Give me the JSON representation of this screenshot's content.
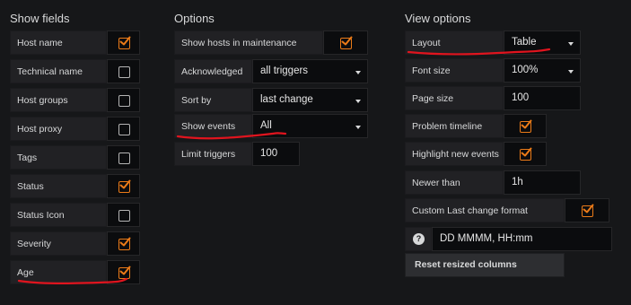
{
  "sections": {
    "show_fields": "Show fields",
    "options": "Options",
    "view_options": "View options"
  },
  "show_fields": [
    {
      "label": "Host name",
      "checked": true
    },
    {
      "label": "Technical name",
      "checked": false
    },
    {
      "label": "Host groups",
      "checked": false
    },
    {
      "label": "Host proxy",
      "checked": false
    },
    {
      "label": "Tags",
      "checked": false
    },
    {
      "label": "Status",
      "checked": true
    },
    {
      "label": "Status Icon",
      "checked": false
    },
    {
      "label": "Severity",
      "checked": true
    },
    {
      "label": "Age",
      "checked": true
    }
  ],
  "options": {
    "show_maintenance": {
      "label": "Show hosts in maintenance",
      "checked": true
    },
    "acknowledged": {
      "label": "Acknowledged",
      "value": "all triggers"
    },
    "sort_by": {
      "label": "Sort by",
      "value": "last change"
    },
    "show_events": {
      "label": "Show events",
      "value": "All"
    },
    "limit_triggers": {
      "label": "Limit triggers",
      "value": "100"
    }
  },
  "view_options": {
    "layout": {
      "label": "Layout",
      "value": "Table"
    },
    "font_size": {
      "label": "Font size",
      "value": "100%"
    },
    "page_size": {
      "label": "Page size",
      "value": "100"
    },
    "problem_timeline": {
      "label": "Problem timeline",
      "checked": true
    },
    "highlight_new": {
      "label": "Highlight new events",
      "checked": true
    },
    "newer_than": {
      "label": "Newer than",
      "value": "1h"
    },
    "custom_format": {
      "label": "Custom Last change format",
      "checked": true
    },
    "format_value": "DD MMMM, HH:mm",
    "help_glyph": "?",
    "reset_button": "Reset resized columns"
  },
  "colors": {
    "accent": "#eb7b18",
    "annotation": "#e0141e",
    "background": "#161719"
  }
}
